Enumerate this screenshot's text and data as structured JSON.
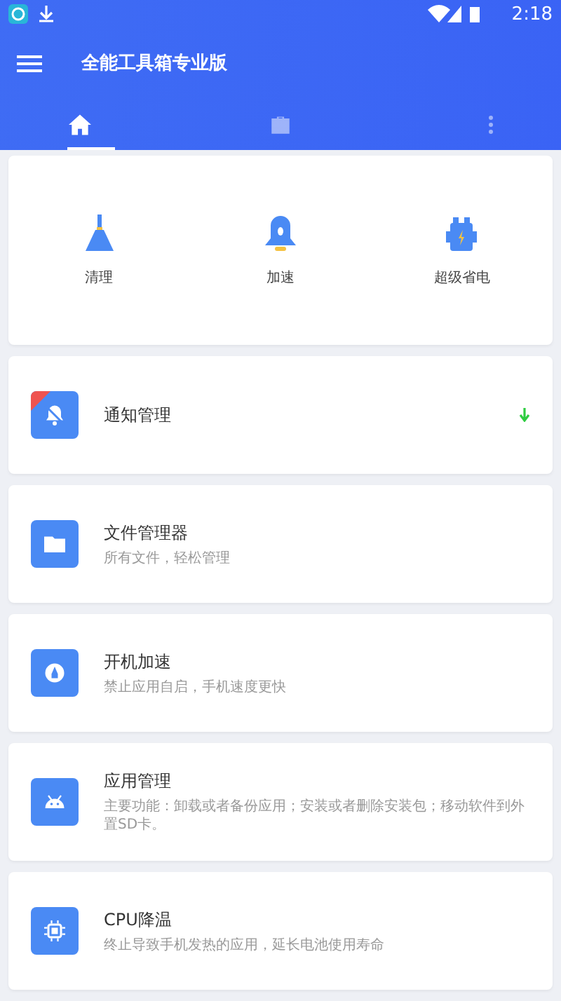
{
  "status_bar": {
    "time": "2:18"
  },
  "app_bar": {
    "title": "全能工具箱专业版"
  },
  "tabs": [
    {
      "selected": true
    },
    {
      "selected": false
    },
    {
      "selected": false
    }
  ],
  "quick_actions": [
    {
      "label": "清理"
    },
    {
      "label": "加速"
    },
    {
      "label": "超级省电"
    }
  ],
  "tools": [
    {
      "title": "通知管理",
      "badge": true,
      "download": true
    },
    {
      "title": "文件管理器",
      "subtitle": "所有文件，轻松管理"
    },
    {
      "title": "开机加速",
      "subtitle": "禁止应用自启，手机速度更快"
    },
    {
      "title": "应用管理",
      "subtitle": "主要功能：卸载或者备份应用；安装或者删除安装包；移动软件到外置SD卡。"
    },
    {
      "title": "CPU降温",
      "subtitle": "终止导致手机发热的应用，延长电池使用寿命"
    }
  ]
}
